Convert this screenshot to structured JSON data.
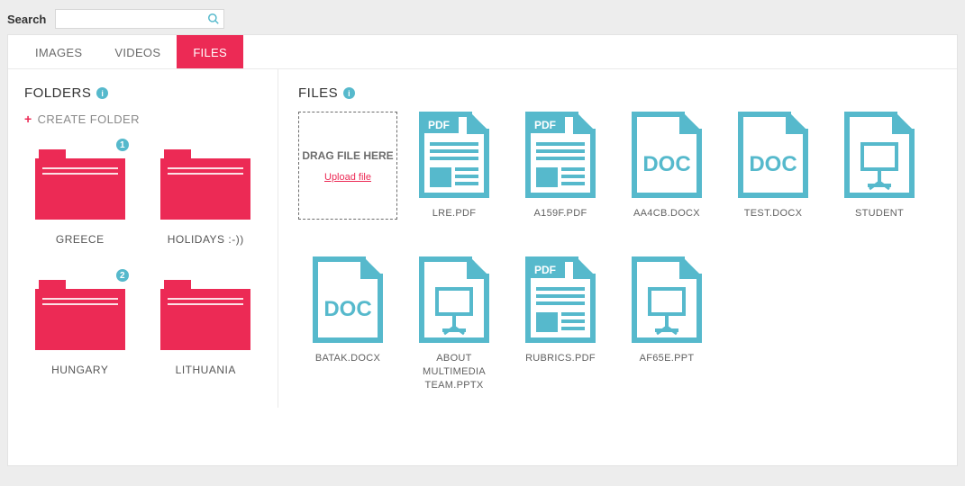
{
  "search": {
    "label": "Search",
    "placeholder": ""
  },
  "tabs": [
    {
      "id": "images",
      "label": "IMAGES",
      "active": false
    },
    {
      "id": "videos",
      "label": "VIDEOS",
      "active": false
    },
    {
      "id": "files",
      "label": "FILES",
      "active": true
    }
  ],
  "sidebar": {
    "title": "FOLDERS",
    "createLabel": "CREATE FOLDER",
    "folders": [
      {
        "name": "GREECE",
        "badge": "1"
      },
      {
        "name": "HOLIDAYS :-))",
        "badge": null
      },
      {
        "name": "HUNGARY",
        "badge": "2"
      },
      {
        "name": "LITHUANIA",
        "badge": null
      }
    ]
  },
  "filesPanel": {
    "title": "FILES",
    "dropzone": {
      "text": "DRAG FILE HERE",
      "link": "Upload file"
    },
    "files": [
      {
        "name": "LRE.PDF",
        "type": "pdf"
      },
      {
        "name": "A159F.PDF",
        "type": "pdf"
      },
      {
        "name": "AA4CB.DOCX",
        "type": "doc"
      },
      {
        "name": "TEST.DOCX",
        "type": "doc"
      },
      {
        "name": "STUDENT",
        "type": "ppt"
      },
      {
        "name": "BATAK.DOCX",
        "type": "doc"
      },
      {
        "name": "ABOUT MULTIMEDIA TEAM.PPTX",
        "type": "ppt"
      },
      {
        "name": "RUBRICS.PDF",
        "type": "pdf"
      },
      {
        "name": "AF65E.PPT",
        "type": "ppt"
      }
    ]
  },
  "colors": {
    "accent": "#ec2a55",
    "teal": "#56b9cc"
  }
}
